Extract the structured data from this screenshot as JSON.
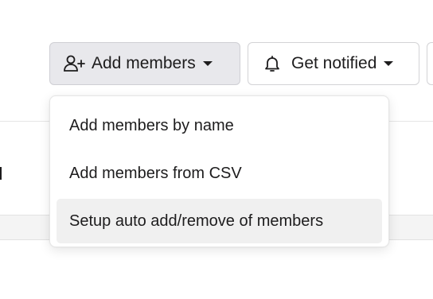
{
  "toolbar": {
    "add_members_label": "Add members",
    "add_members_icon": "user-plus-icon",
    "get_notified_label": "Get notified",
    "get_notified_icon": "bell-icon"
  },
  "add_members_menu": {
    "items": [
      {
        "label": "Add members by name"
      },
      {
        "label": "Add members from CSV"
      },
      {
        "label": "Setup auto add/remove of members",
        "highlighted": true
      }
    ]
  },
  "colors": {
    "active_button_bg": "#e8e8ec",
    "menu_hover_bg": "#f0f0f0",
    "text": "#1d1c1d"
  }
}
